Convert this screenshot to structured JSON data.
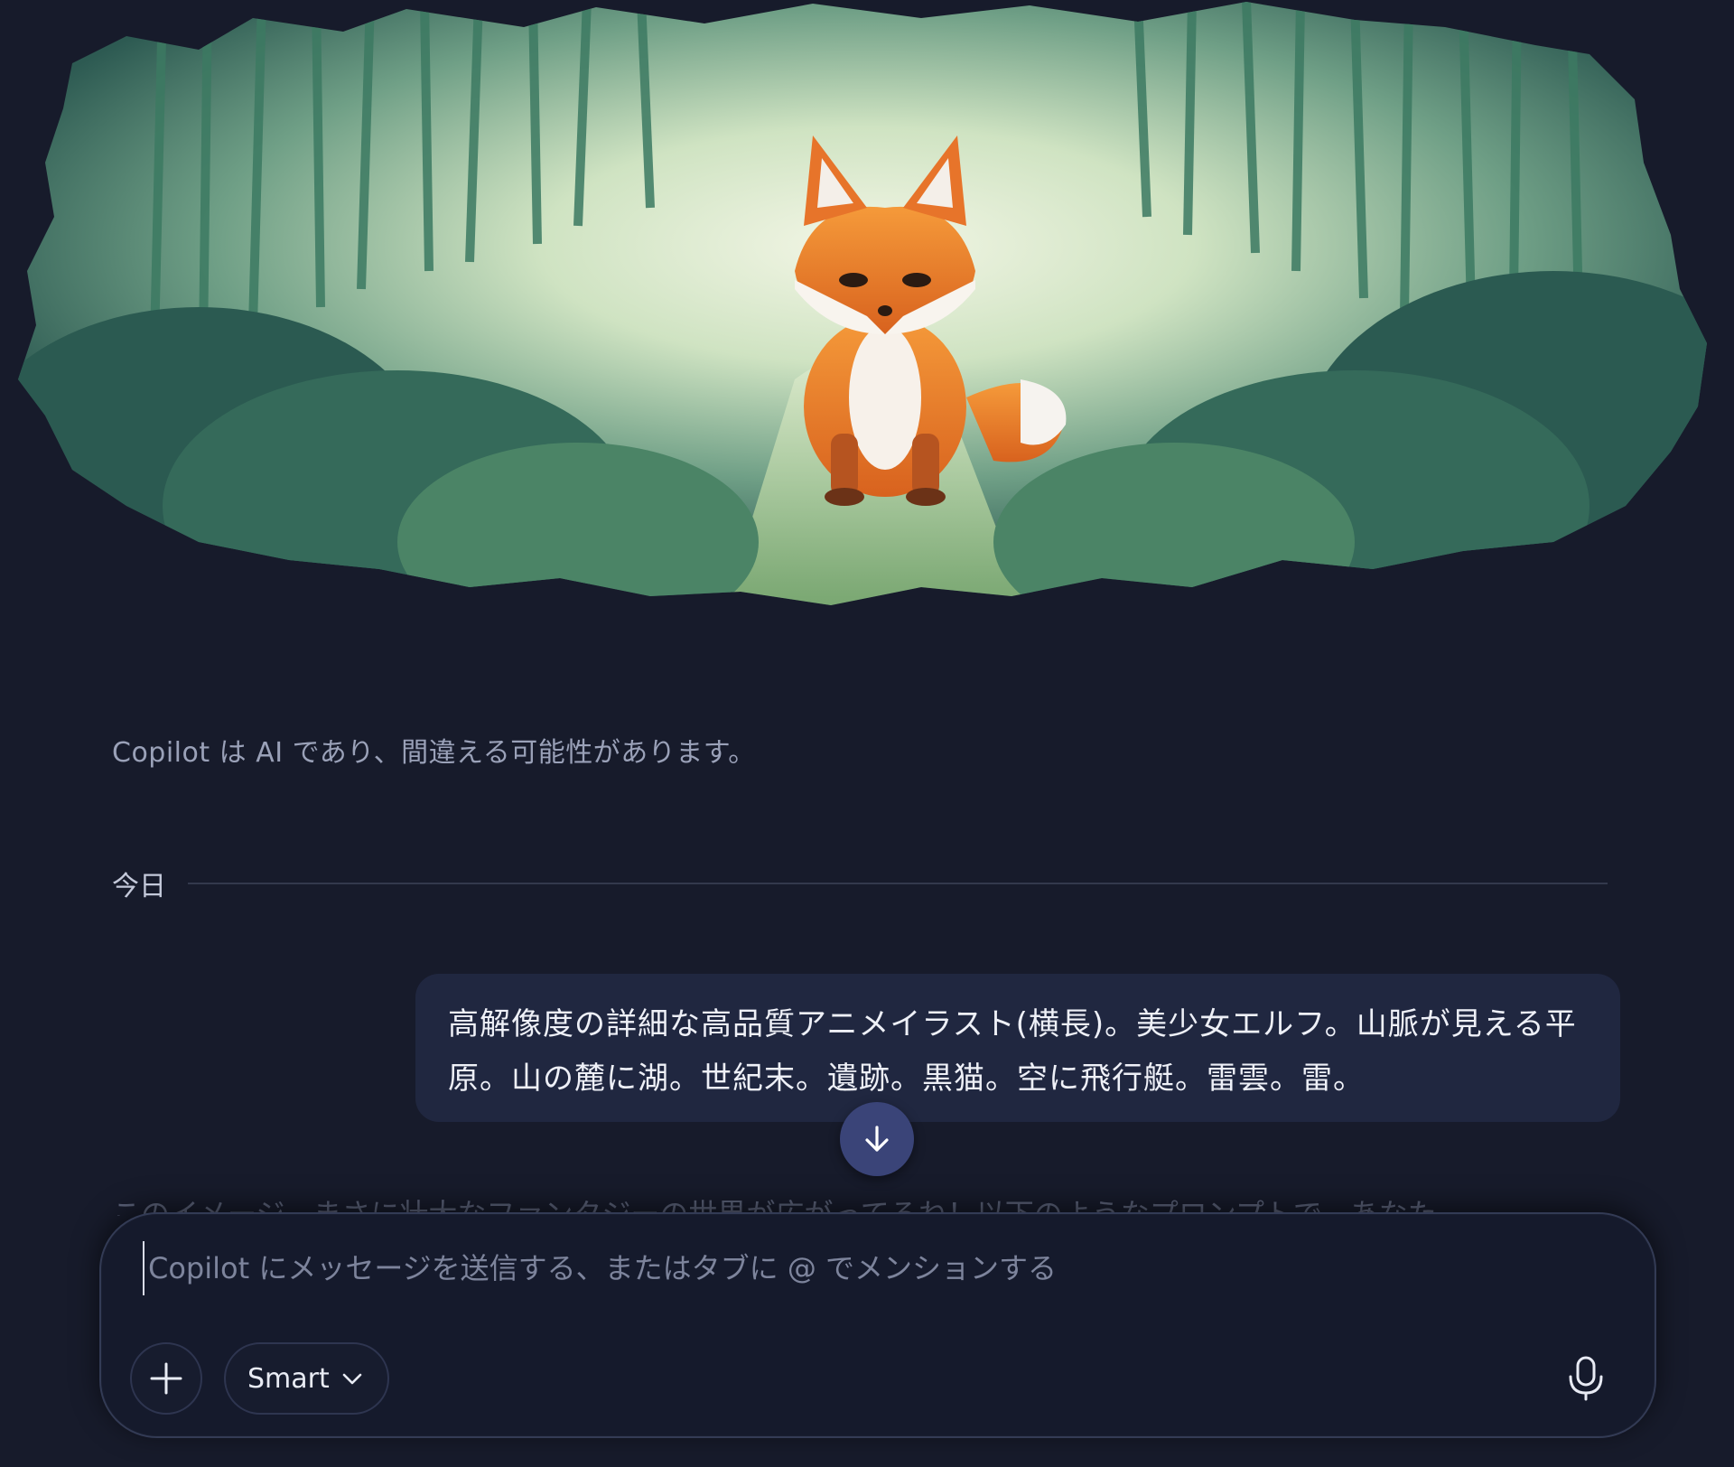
{
  "disclaimer": "Copilot は AI であり、間違える可能性があります。",
  "divider": {
    "label": "今日"
  },
  "user_message": {
    "text": "高解像度の詳細な高品質アニメイラスト(横長)。美少女エルフ。山脈が見える平原。山の麓に湖。世紀末。遺跡。黒猫。空に飛行艇。雷雲。雷。"
  },
  "assistant_preview": {
    "text": "このイメージ、まさに壮大なファンタジーの世界が広がってるね！以下のようなプロンプトで、あなた"
  },
  "composer": {
    "placeholder": "Copilot にメッセージを送信する、またはタブに @ でメンションする",
    "value": "",
    "mode_label": "Smart"
  },
  "icons": {
    "scroll": "arrow-down-icon",
    "add": "plus-icon",
    "mode": "chevron-down-icon",
    "voice": "microphone-icon"
  },
  "colors": {
    "background": "#171b2b",
    "bubble": "#202740",
    "scroll_button": "#3a4478",
    "composer": "#151a2c"
  }
}
